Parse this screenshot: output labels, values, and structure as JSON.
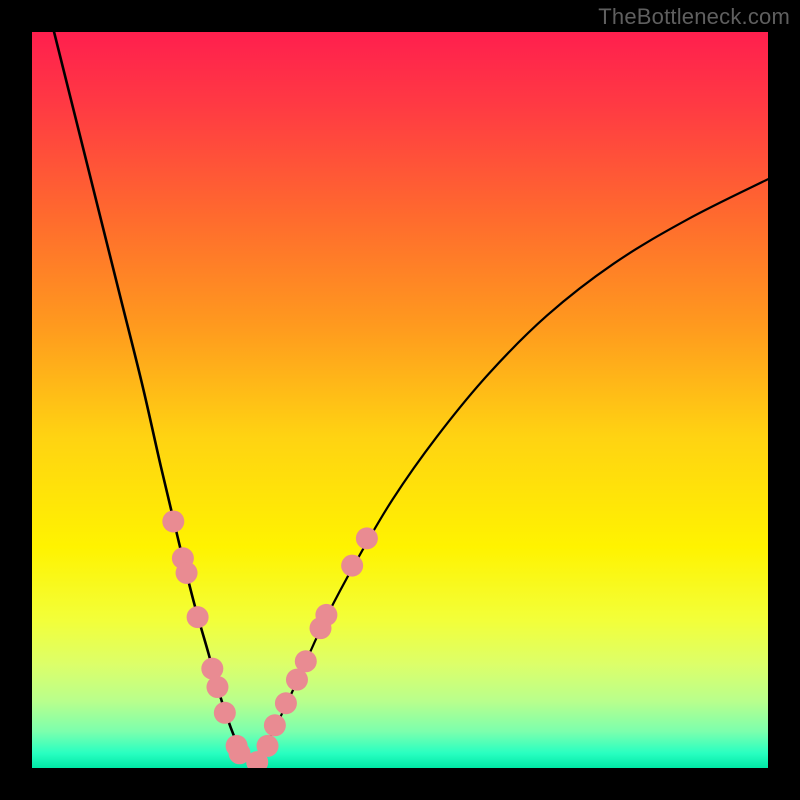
{
  "watermark": "TheBottleneck.com",
  "chart_data": {
    "type": "line",
    "title": "",
    "xlabel": "",
    "ylabel": "",
    "xlim": [
      0,
      1
    ],
    "ylim": [
      0,
      1
    ],
    "notes": "Qualitative bottleneck curve. Axes unlabeled; x is relative component balance (0..1), y is relative bottleneck severity (1 at top → 0 at bottom). Gradient background: red (high) → yellow (mid) → green (low). Two black curves forming a V with minimum near x≈0.30. Pink dots mark sample points along both sides of the valley in the lower region.",
    "gradient_stops": [
      {
        "offset": 0.0,
        "color": "#ff1f4e"
      },
      {
        "offset": 0.1,
        "color": "#ff3a43"
      },
      {
        "offset": 0.25,
        "color": "#ff6a2e"
      },
      {
        "offset": 0.4,
        "color": "#ff9a1e"
      },
      {
        "offset": 0.55,
        "color": "#ffd312"
      },
      {
        "offset": 0.7,
        "color": "#fff300"
      },
      {
        "offset": 0.8,
        "color": "#f2ff3a"
      },
      {
        "offset": 0.86,
        "color": "#dcff6a"
      },
      {
        "offset": 0.91,
        "color": "#b8ff8d"
      },
      {
        "offset": 0.95,
        "color": "#7dffad"
      },
      {
        "offset": 0.98,
        "color": "#28ffc1"
      },
      {
        "offset": 1.0,
        "color": "#00e8a6"
      }
    ],
    "series": [
      {
        "name": "left-branch",
        "x": [
          0.03,
          0.06,
          0.09,
          0.12,
          0.15,
          0.175,
          0.2,
          0.22,
          0.24,
          0.255,
          0.27,
          0.283,
          0.3
        ],
        "y": [
          1.0,
          0.88,
          0.76,
          0.64,
          0.52,
          0.41,
          0.305,
          0.225,
          0.155,
          0.1,
          0.055,
          0.025,
          0.0
        ]
      },
      {
        "name": "right-branch",
        "x": [
          0.3,
          0.32,
          0.345,
          0.37,
          0.4,
          0.44,
          0.49,
          0.55,
          0.62,
          0.7,
          0.79,
          0.89,
          1.0
        ],
        "y": [
          0.0,
          0.035,
          0.085,
          0.14,
          0.205,
          0.28,
          0.365,
          0.45,
          0.535,
          0.615,
          0.685,
          0.745,
          0.8
        ]
      }
    ],
    "markers": {
      "color": "#e98b92",
      "radius_px": 11,
      "points": [
        {
          "x": 0.192,
          "y": 0.335
        },
        {
          "x": 0.205,
          "y": 0.285
        },
        {
          "x": 0.21,
          "y": 0.265
        },
        {
          "x": 0.225,
          "y": 0.205
        },
        {
          "x": 0.245,
          "y": 0.135
        },
        {
          "x": 0.252,
          "y": 0.11
        },
        {
          "x": 0.262,
          "y": 0.075
        },
        {
          "x": 0.278,
          "y": 0.03
        },
        {
          "x": 0.282,
          "y": 0.02
        },
        {
          "x": 0.306,
          "y": 0.008
        },
        {
          "x": 0.32,
          "y": 0.03
        },
        {
          "x": 0.33,
          "y": 0.058
        },
        {
          "x": 0.345,
          "y": 0.088
        },
        {
          "x": 0.36,
          "y": 0.12
        },
        {
          "x": 0.372,
          "y": 0.145
        },
        {
          "x": 0.392,
          "y": 0.19
        },
        {
          "x": 0.4,
          "y": 0.208
        },
        {
          "x": 0.435,
          "y": 0.275
        },
        {
          "x": 0.455,
          "y": 0.312
        }
      ]
    }
  }
}
